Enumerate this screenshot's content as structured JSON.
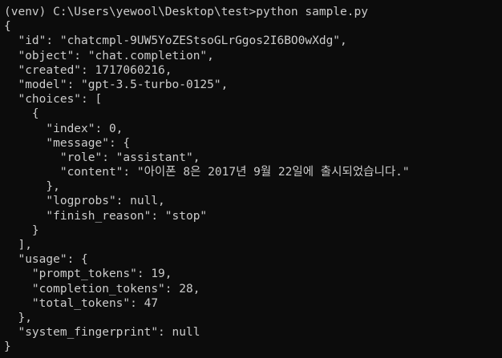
{
  "terminal": {
    "lines": [
      "(venv) C:\\Users\\yewool\\Desktop\\test>python sample.py",
      "{",
      "  \"id\": \"chatcmpl-9UW5YoZEStsoGLrGgos2I6BO0wXdg\",",
      "  \"object\": \"chat.completion\",",
      "  \"created\": 1717060216,",
      "  \"model\": \"gpt-3.5-turbo-0125\",",
      "  \"choices\": [",
      "    {",
      "      \"index\": 0,",
      "      \"message\": {",
      "        \"role\": \"assistant\",",
      "        \"content\": \"아이폰 8은 2017년 9월 22일에 출시되었습니다.\"",
      "      },",
      "      \"logprobs\": null,",
      "      \"finish_reason\": \"stop\"",
      "    }",
      "  ],",
      "  \"usage\": {",
      "    \"prompt_tokens\": 19,",
      "    \"completion_tokens\": 28,",
      "    \"total_tokens\": 47",
      "  },",
      "  \"system_fingerprint\": null",
      "}"
    ]
  }
}
